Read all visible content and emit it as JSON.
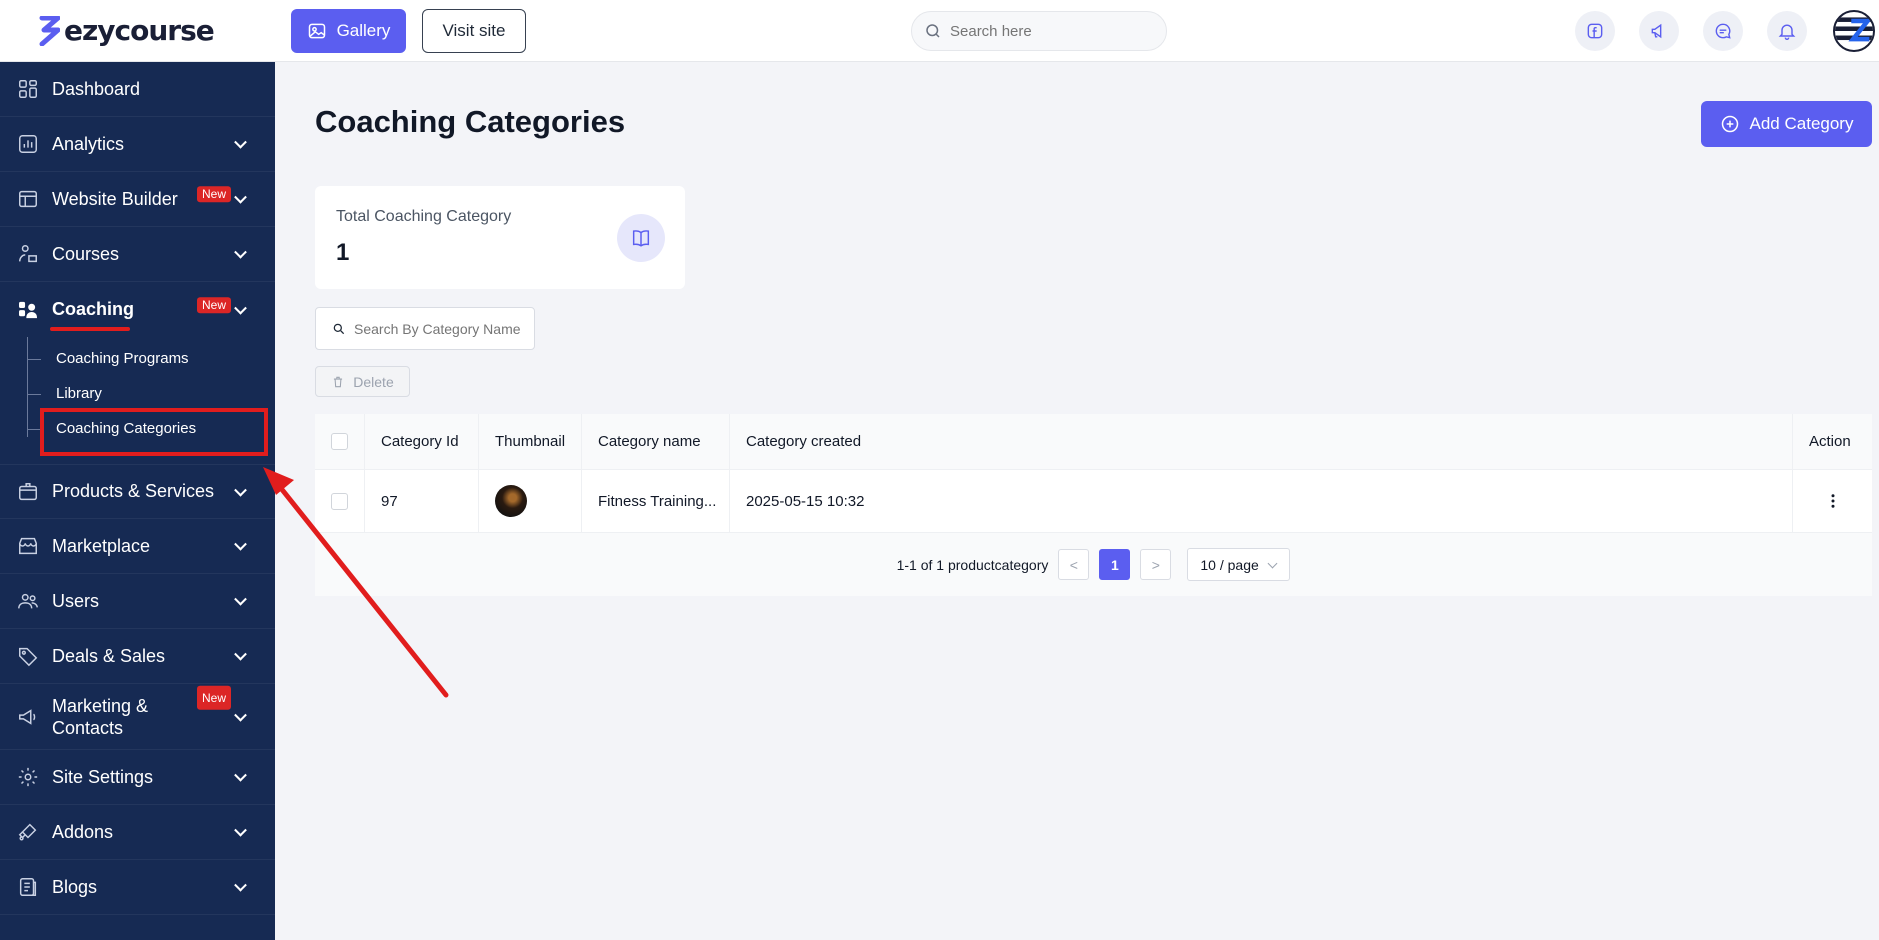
{
  "brand": {
    "name": "ezycourse"
  },
  "topbar": {
    "gallery_label": "Gallery",
    "visit_label": "Visit site",
    "search_placeholder": "Search here"
  },
  "sidebar": {
    "items": [
      {
        "label": "Dashboard"
      },
      {
        "label": "Analytics"
      },
      {
        "label": "Website Builder",
        "badge": "New"
      },
      {
        "label": "Courses"
      },
      {
        "label": "Coaching",
        "badge": "New"
      },
      {
        "label": "Products & Services"
      },
      {
        "label": "Marketplace"
      },
      {
        "label": "Users"
      },
      {
        "label": "Deals & Sales"
      },
      {
        "label": "Marketing & Contacts",
        "badge": "New"
      },
      {
        "label": "Site Settings"
      },
      {
        "label": "Addons"
      },
      {
        "label": "Blogs"
      }
    ],
    "coaching_sub": [
      {
        "label": "Coaching Programs"
      },
      {
        "label": "Library"
      },
      {
        "label": "Coaching Categories"
      }
    ]
  },
  "main": {
    "title": "Coaching Categories",
    "add_button": "Add Category",
    "stat": {
      "label": "Total Coaching Category",
      "value": "1"
    },
    "search_placeholder": "Search By Category Name",
    "delete_label": "Delete",
    "table": {
      "headers": [
        "Category Id",
        "Thumbnail",
        "Category name",
        "Category created",
        "Action"
      ],
      "rows": [
        {
          "id": "97",
          "name": "Fitness Training...",
          "created": "2025-05-15 10:32"
        }
      ]
    },
    "pagination": {
      "summary": "1-1 of 1 productcategory",
      "prev": "<",
      "current": "1",
      "next": ">",
      "page_size": "10 / page"
    }
  },
  "colors": {
    "accent": "#5b5ef0",
    "sidebar_bg": "#162a53",
    "annotation": "#e11d1d"
  }
}
